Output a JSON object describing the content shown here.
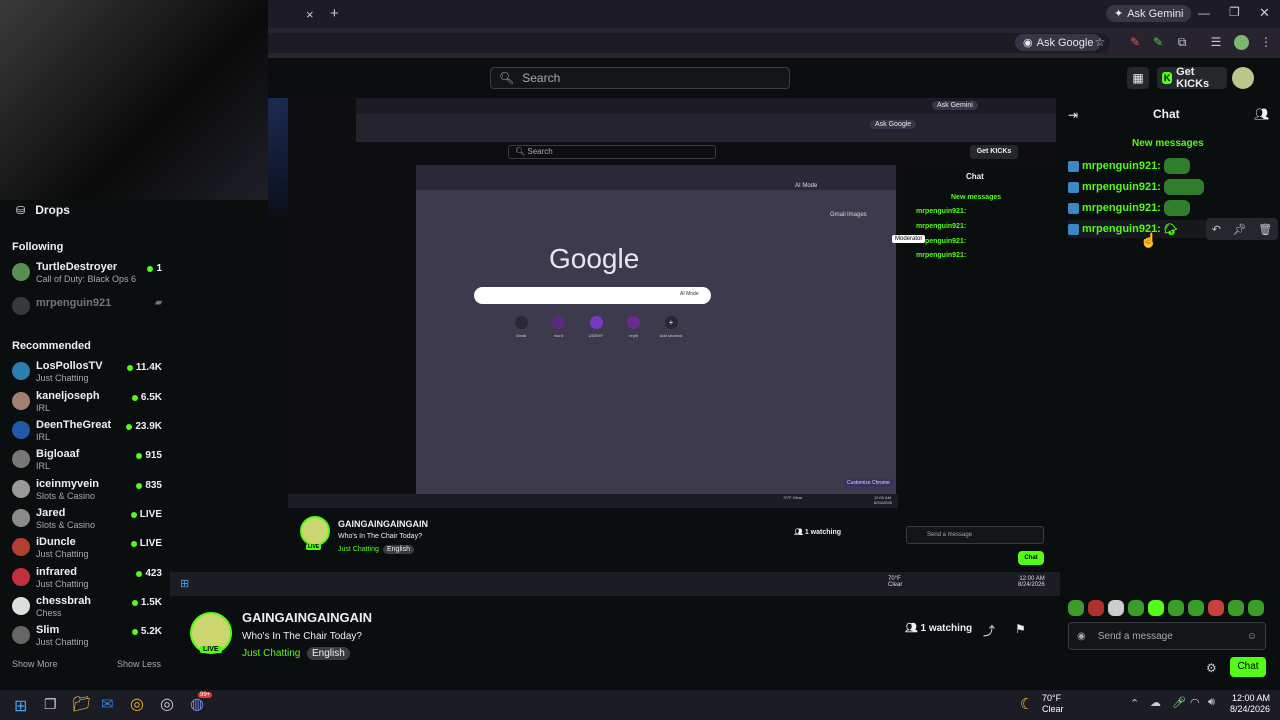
{
  "browser": {
    "ask_gemini": "Ask Gemini",
    "ask_google": "Ask Google",
    "close_tab": "×",
    "new_tab": "+"
  },
  "kick_header": {
    "search_placeholder": "Search",
    "get_kicks": "Get KICKs"
  },
  "sidebar": {
    "drops": "Drops",
    "following_title": "Following",
    "following": [
      {
        "name": "TurtleDestroyer",
        "category": "Call of Duty: Black Ops 6",
        "viewers": "1"
      },
      {
        "name": "mrpenguin921",
        "category": "",
        "viewers": ""
      }
    ],
    "recommended_title": "Recommended",
    "recommended": [
      {
        "name": "LosPollosTV",
        "category": "Just Chatting",
        "viewers": "11.4K"
      },
      {
        "name": "kaneljoseph",
        "category": "IRL",
        "viewers": "6.5K"
      },
      {
        "name": "DeenTheGreat",
        "category": "IRL",
        "viewers": "23.9K"
      },
      {
        "name": "Bigloaaf",
        "category": "IRL",
        "viewers": "915"
      },
      {
        "name": "iceinmyvein",
        "category": "Slots & Casino",
        "viewers": "835"
      },
      {
        "name": "Jared",
        "category": "Slots & Casino",
        "viewers": "LIVE"
      },
      {
        "name": "iDuncle",
        "category": "Just Chatting",
        "viewers": "LIVE"
      },
      {
        "name": "infrared",
        "category": "Just Chatting",
        "viewers": "423"
      },
      {
        "name": "chessbrah",
        "category": "Chess",
        "viewers": "1.5K"
      },
      {
        "name": "Slim",
        "category": "Just Chatting",
        "viewers": "5.2K"
      }
    ],
    "show_more": "Show More",
    "show_less": "Show Less"
  },
  "chat": {
    "title": "Chat",
    "new_messages": "New messages",
    "messages": [
      {
        "user": "mrpenguin921:"
      },
      {
        "user": "mrpenguin921:"
      },
      {
        "user": "mrpenguin921:"
      },
      {
        "user": "mrpenguin921:"
      }
    ],
    "input_placeholder": "Send a message",
    "send": "Chat"
  },
  "inner": {
    "moderator_tooltip": "Moderator",
    "google_logo": "Google",
    "shortcuts": [
      "Gmail",
      "word",
      "UDEMY",
      "replit",
      "Add shortcut"
    ],
    "customize": "Customize Chrome",
    "gmail": "Gmail",
    "images": "Images",
    "ai_mode": "AI Mode",
    "weather_temp": "70°F",
    "weather_cond": "Clear",
    "time": "12:00 AM",
    "date": "8/24/2026"
  },
  "stream": {
    "streamer": "GAINGAINGAINGAIN",
    "title": "Who's In The Chair Today?",
    "category": "Just Chatting",
    "language": "English",
    "live": "LIVE",
    "watching": "1 watching"
  },
  "taskbar": {
    "weather_temp": "70°F",
    "weather_cond": "Clear",
    "time": "12:00 AM",
    "date": "8/24/2026",
    "badge": "99+"
  },
  "colors": {
    "accent": "#53fc18",
    "bg": "#0b0e0f",
    "chrome": "#27242f"
  }
}
